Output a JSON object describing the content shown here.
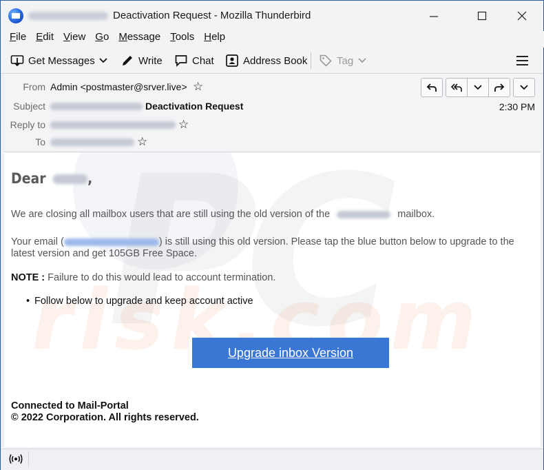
{
  "window": {
    "title": "Deactivation Request - Mozilla Thunderbird",
    "minimize_icon": "minimize-icon",
    "maximize_icon": "maximize-icon",
    "close_icon": "close-icon"
  },
  "menubar": {
    "items": [
      {
        "label": "File",
        "accel": "F",
        "rest": "ile"
      },
      {
        "label": "Edit",
        "accel": "E",
        "rest": "dit"
      },
      {
        "label": "View",
        "accel": "V",
        "rest": "iew"
      },
      {
        "label": "Go",
        "accel": "G",
        "rest": "o"
      },
      {
        "label": "Message",
        "accel": "M",
        "rest": "essage"
      },
      {
        "label": "Tools",
        "accel": "T",
        "rest": "ools"
      },
      {
        "label": "Help",
        "accel": "H",
        "rest": "elp"
      }
    ]
  },
  "toolbar": {
    "get_messages": "Get Messages",
    "write": "Write",
    "chat": "Chat",
    "address_book": "Address Book",
    "tag": "Tag"
  },
  "header": {
    "from_label": "From",
    "from_value": "Admin <postmaster@srver.live>",
    "subject_label": "Subject",
    "subject_value": "Deactivation Request",
    "replyto_label": "Reply to",
    "to_label": "To",
    "time": "2:30 PM"
  },
  "message": {
    "dear": "Dear",
    "para1_a": "We are closing all mailbox users that are still using the old version of  the",
    "para1_b": "mailbox.",
    "para2_a": "Your email   (",
    "para2_b": ")  is still using this old version. Please tap the blue button below to upgrade to the latest version and get 105GB Free Space.",
    "note_label": "NOTE :",
    "note_text": " Failure to do this would lead to account termination.",
    "bullet": "Follow  below to upgrade and keep account active",
    "cta": "Upgrade inbox Version ",
    "footer_line1": "Connected to Mail-Portal",
    "footer_line2": "© 2022  Corporation. All rights reserved."
  },
  "colors": {
    "cta_bg": "#3a76d3",
    "window_border": "#2a5aa8"
  }
}
